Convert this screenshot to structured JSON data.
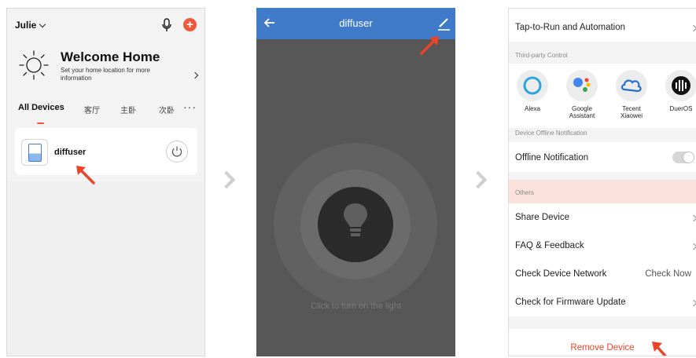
{
  "screen1": {
    "user": "Julie",
    "welcome_title": "Welcome Home",
    "welcome_subtitle": "Set your home location for more information",
    "tabs": [
      "All Devices",
      "客厅",
      "主卧",
      "次卧"
    ],
    "more": "···",
    "device_name": "diffuser"
  },
  "screen2": {
    "title": "diffuser",
    "hint": "Click to turn on the light"
  },
  "screen3": {
    "tap_to_run": "Tap-to-Run and Automation",
    "third_party_label": "Third-party Control",
    "third_party": [
      "Alexa",
      "Google\nAssistant",
      "Tecent\nXiaowei",
      "DuerOS"
    ],
    "offline_label": "Device Offline Notification",
    "offline_notification": "Offline Notification",
    "others_label": "Others",
    "share_device": "Share Device",
    "faq": "FAQ & Feedback",
    "check_network": "Check Device Network",
    "check_now": "Check Now",
    "firmware": "Check for Firmware Update",
    "remove": "Remove Device"
  },
  "colors": {
    "accent_red": "#e8452a",
    "header_blue": "#3f7bc9",
    "dark_bg": "#575757"
  }
}
